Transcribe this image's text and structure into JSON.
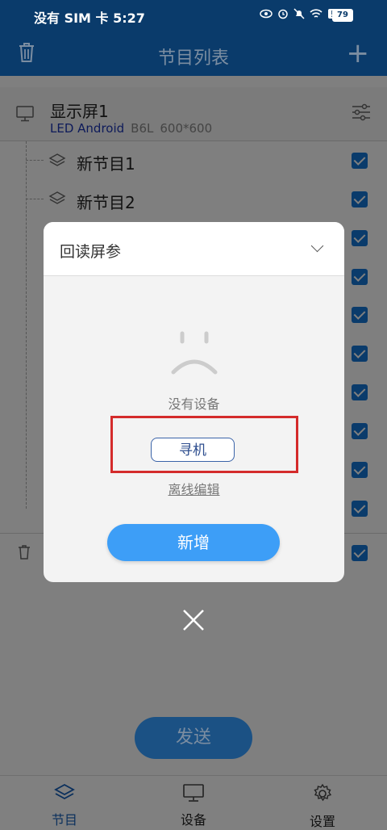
{
  "status_bar": {
    "carrier_time": "没有 SIM 卡 5:27",
    "battery": "79"
  },
  "header": {
    "title": "节目列表"
  },
  "screen": {
    "name": "显示屏1",
    "type": "LED Android",
    "model": "B6L",
    "resolution": "600*600"
  },
  "programs": [
    {
      "label": "新节目1"
    },
    {
      "label": "新节目2"
    }
  ],
  "modal": {
    "title": "回读屏参",
    "no_device": "没有设备",
    "search_button": "寻机",
    "offline_edit": "离线编辑",
    "add_button": "新增"
  },
  "send_button": "发送",
  "bottom_nav": [
    {
      "label": "节目"
    },
    {
      "label": "设备"
    },
    {
      "label": "设置"
    }
  ],
  "colors": {
    "header_bg": "#0a3b6b",
    "accent": "#3d9ef7",
    "highlight": "#d42b2b"
  }
}
